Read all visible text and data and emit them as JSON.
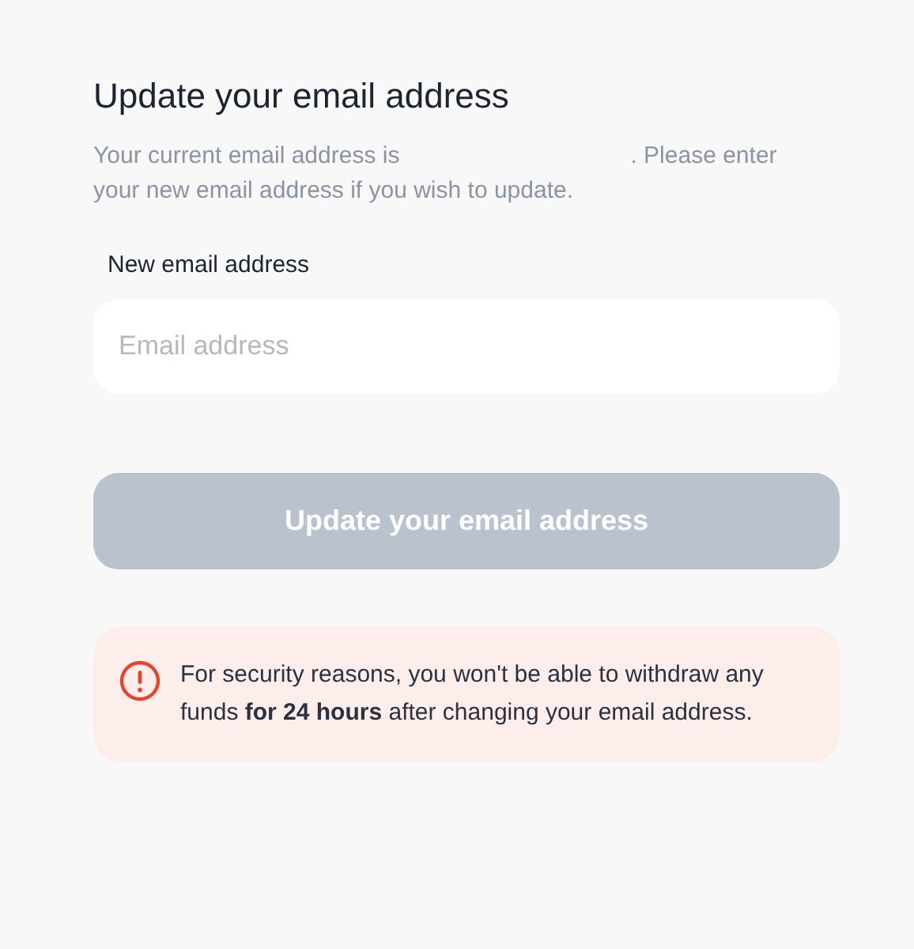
{
  "title": "Update your email address",
  "description": {
    "before": "Your current email address is",
    "after": ". Please enter",
    "line_2": "your new email address if you wish to update."
  },
  "field": {
    "label": "New email address",
    "placeholder": "Email address"
  },
  "button": {
    "label": "Update your email address",
    "disabled": true
  },
  "notice": {
    "text": "For security reasons, you won't be able to withdraw any funds **for 24 hours** after changing your email address."
  }
}
